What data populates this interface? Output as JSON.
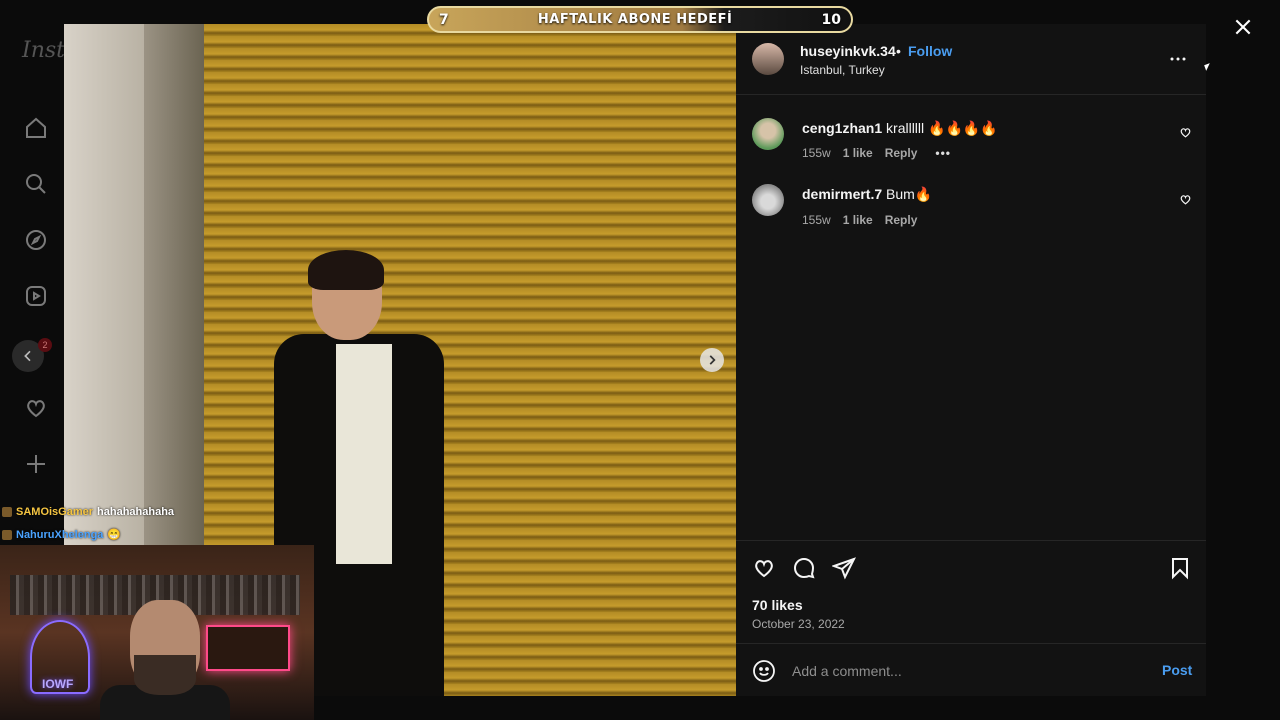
{
  "background_app": {
    "logo": "Inst",
    "sidebar_items": [
      {
        "name": "home-icon"
      },
      {
        "name": "search-icon"
      },
      {
        "name": "explore-icon"
      },
      {
        "name": "reels-icon"
      },
      {
        "name": "back-icon"
      },
      {
        "name": "notifications-icon"
      },
      {
        "name": "create-icon"
      }
    ],
    "notification_count": "2"
  },
  "stream_overlay": {
    "goal_current": "7",
    "goal_title": "HAFTALIK ABONE HEDEFİ",
    "goal_target": "10",
    "goal_progress": 0.7,
    "chat": [
      {
        "user": "SAMOisGamer",
        "user_color": "#f5c542",
        "message": "hahahahahaha"
      },
      {
        "user": "NahuruXhelenga",
        "user_color": "#4aa3ff",
        "message": "😁"
      }
    ],
    "webcam_sign": "IOWF"
  },
  "post": {
    "author": "huseyinkvk.34",
    "separator": "•",
    "follow_label": "Follow",
    "location": "Istanbul, Turkey",
    "comments": [
      {
        "user": "ceng1zhan1",
        "text": "krallllll 🔥🔥🔥🔥",
        "age": "155w",
        "likes": "1 like",
        "reply_label": "Reply",
        "more": "•••"
      },
      {
        "user": "demirmert.7",
        "text": "Bum🔥",
        "age": "155w",
        "likes": "1 like",
        "reply_label": "Reply"
      }
    ],
    "likes": "70 likes",
    "date": "October 23, 2022",
    "comment_placeholder": "Add a comment...",
    "post_label": "Post"
  },
  "colors": {
    "accent": "#4a9df0",
    "panel_bg": "#121212",
    "secondary_text": "#a8a8a8"
  }
}
